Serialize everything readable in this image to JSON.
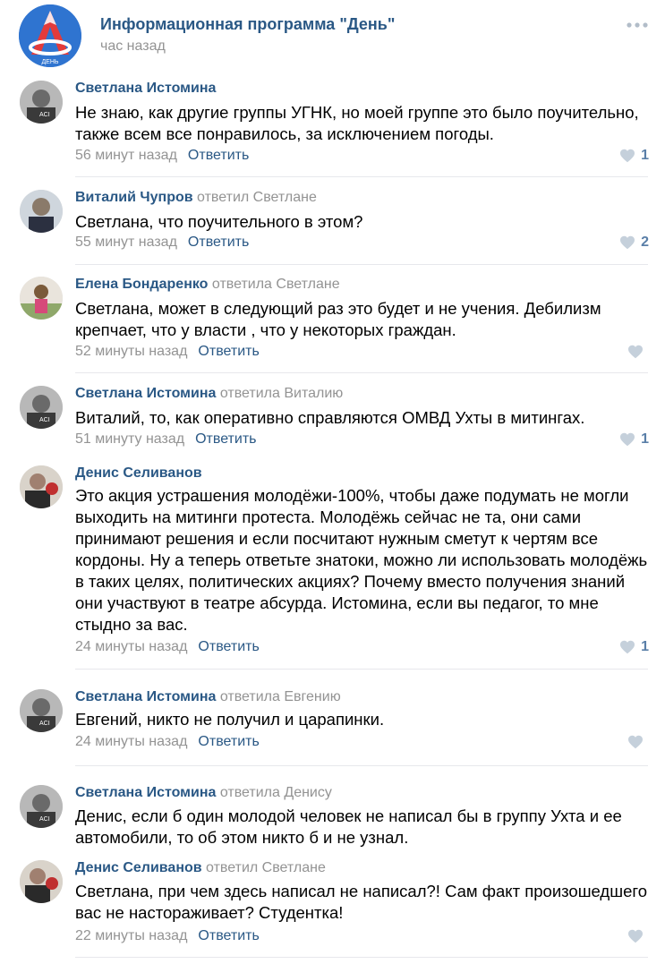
{
  "post": {
    "group_name": "Информационная программа \"День\"",
    "time": "час назад",
    "avatar_caption": "ДЕНЬ"
  },
  "comments": [
    {
      "author": "Светлана Истомина",
      "replied_label": "",
      "reply_to": "",
      "text": "Не знаю, как другие группы УГНК, но моей группе это было поучительно, также всем все понравилось, за исключением погоды.",
      "time": "56 минут назад",
      "reply_label": "Ответить",
      "likes": "1"
    },
    {
      "author": "Виталий Чупров",
      "replied_label": "ответил",
      "reply_to": "Светлане",
      "text": "Светлана, что поучительного в этом?",
      "time": "55 минут назад",
      "reply_label": "Ответить",
      "likes": "2"
    },
    {
      "author": "Елена Бондаренко",
      "replied_label": "ответила",
      "reply_to": "Светлане",
      "text": "Светлана, может в следующий раз это будет и не учения. Дебилизм крепчает, что у власти , что у некоторых граждан.",
      "time": "52 минуты назад",
      "reply_label": "Ответить",
      "likes": ""
    },
    {
      "author": "Светлана Истомина",
      "replied_label": "ответила",
      "reply_to": "Виталию",
      "text": "Виталий, то, как оперативно справляются ОМВД Ухты в митингах.",
      "time": "51 минуту назад",
      "reply_label": "Ответить",
      "likes": "1"
    },
    {
      "author": "Денис Селиванов",
      "replied_label": "",
      "reply_to": "",
      "text": "Это акция устрашения молодёжи-100%, чтобы даже подумать не могли выходить на митинги протеста. Молодёжь сейчас не та, они сами принимают решения и если посчитают нужным сметут к чертям все кордоны. Ну а теперь ответьте знатоки, можно ли использовать молодёжь в таких целях, политических акциях? Почему вместо получения знаний они участвуют в театре абсурда. Истомина, если вы педагог, то мне стыдно за вас.",
      "time": "24 минуты назад",
      "reply_label": "Ответить",
      "likes": "1"
    },
    {
      "author": "Светлана Истомина",
      "replied_label": "ответила",
      "reply_to": "Евгению",
      "text": "Евгений, никто не получил и царапинки.",
      "time": "24 минуты назад",
      "reply_label": "Ответить",
      "likes": ""
    },
    {
      "author": "Светлана Истомина",
      "replied_label": "ответила",
      "reply_to": "Денису",
      "text": "Денис, если б один молодой человек не написал бы в группу Ухта и ее автомобили, то об этом никто б и не узнал.",
      "time": "",
      "reply_label": "",
      "likes": ""
    },
    {
      "author": "Денис Селиванов",
      "replied_label": "ответил",
      "reply_to": "Светлане",
      "text": "Светлана, при чем здесь написал не написал?! Сам факт произошедшего вас не настораживает? Студентка!",
      "time": "22 минуты назад",
      "reply_label": "Ответить",
      "likes": ""
    }
  ],
  "colors": {
    "link": "#2a5885",
    "meta": "#939393",
    "like_icon": "#c5d0db",
    "like_count": "#5a7fa8",
    "group_avatar_bg": "#2f74d0"
  },
  "icons": {
    "more": "more-dots-icon",
    "like": "heart-icon"
  }
}
